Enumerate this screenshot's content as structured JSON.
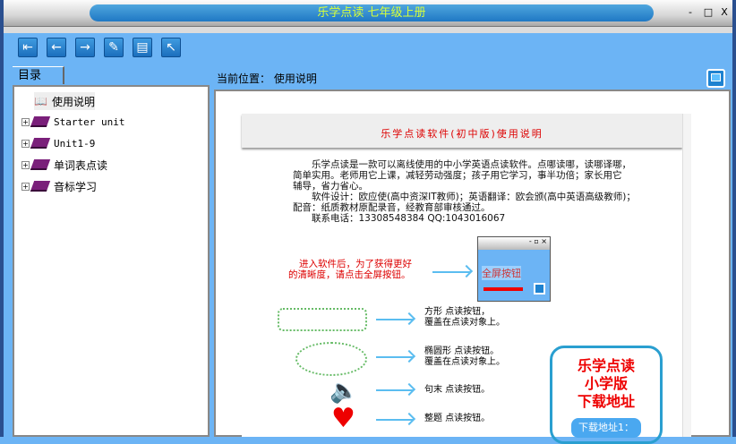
{
  "window": {
    "title": "乐学点读  七年级上册",
    "min": "-",
    "max": "□",
    "close": "X"
  },
  "toolbar": {
    "buttons": [
      "exit-icon",
      "back-icon",
      "forward-icon",
      "notes-icon",
      "bookmark-icon",
      "pointer-icon"
    ]
  },
  "sidebar": {
    "tab": "目录",
    "items": [
      {
        "label": "使用说明"
      },
      {
        "label": "Starter unit"
      },
      {
        "label": "Unit1-9"
      },
      {
        "label": "单词表点读"
      },
      {
        "label": "音标学习"
      }
    ]
  },
  "main": {
    "location": "当前位置： 使用说明"
  },
  "doc": {
    "title": "乐学点读软件(初中版)使用说明",
    "para": [
      "　　乐学点读是一款可以离线使用的中小学英语点读软件。点哪读哪，读哪译哪，",
      "简单实用。老师用它上课，减轻劳动强度；孩子用它学习，事半功倍；家长用它",
      "辅导，省力省心。",
      "　　软件设计：欧应使(高中资深IT教师)；英语翻译：欧会颁(高中英语高级教师)；",
      "配音：纸质教材原配录音，经教育部审核通过。",
      "　　联系电话：13308548384  QQ:1043016067"
    ],
    "fullscreen_tip": [
      "进入软件后，为了获得更好",
      "的清晰度，请点击全屏按钮。"
    ],
    "thumb_label": "全屏按钮",
    "rect_label": [
      "方形 点读按钮，",
      "覆盖在点读对象上。"
    ],
    "ellipse_label": [
      "椭圆形 点读按钮。",
      "覆盖在点读对象上。"
    ],
    "sentence_label": "句末 点读按钮。",
    "whole_label": "整题 点读按钮。",
    "promo": [
      "乐学点读",
      "小学版",
      "下载地址"
    ],
    "download_btn": "下载地址1："
  }
}
